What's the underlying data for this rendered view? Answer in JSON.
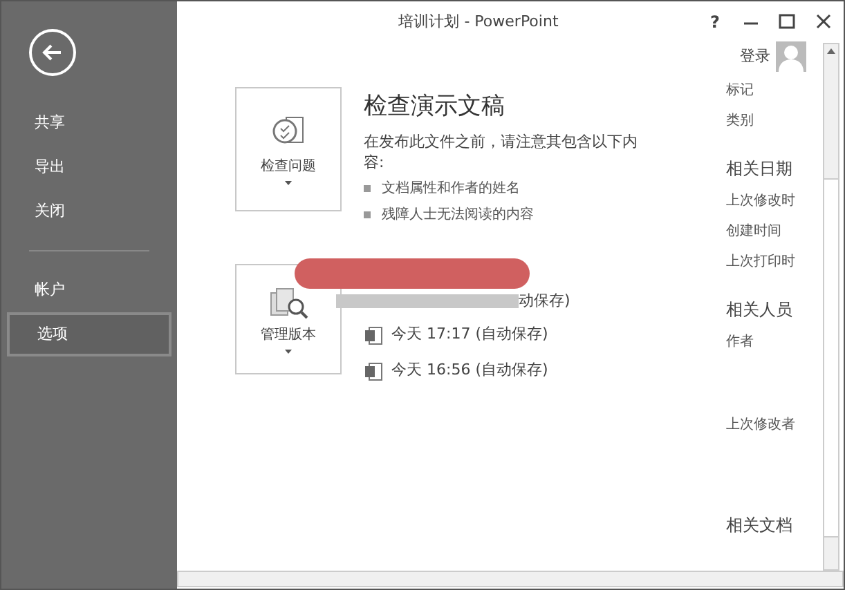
{
  "window": {
    "title": "培训计划 - PowerPoint",
    "signin": "登录",
    "help": "?"
  },
  "sidebar": {
    "groups": [
      [
        {
          "label": "共享",
          "selected": false
        },
        {
          "label": "导出",
          "selected": false
        },
        {
          "label": "关闭",
          "selected": false
        }
      ],
      [
        {
          "label": "帐户",
          "selected": false
        },
        {
          "label": "选项",
          "selected": true
        }
      ]
    ]
  },
  "inspect": {
    "button": "检查问题",
    "title": "检查演示文稿",
    "desc": "在发布此文件之前，请注意其包含以下内容:",
    "bullets": [
      "文档属性和作者的姓名",
      "残障人士无法阅读的内容"
    ]
  },
  "versions": {
    "button": "管理版本",
    "items": [
      {
        "label": "动保存)",
        "redacted": true
      },
      {
        "label": "今天 17:17 (自动保存)",
        "redacted": false
      },
      {
        "label": "今天 16:56 (自动保存)",
        "redacted": false
      }
    ]
  },
  "properties": [
    {
      "kind": "label",
      "text": "标记"
    },
    {
      "kind": "label",
      "text": "类别"
    },
    {
      "kind": "heading",
      "text": "相关日期"
    },
    {
      "kind": "label",
      "text": "上次修改时"
    },
    {
      "kind": "label",
      "text": "创建时间"
    },
    {
      "kind": "label",
      "text": "上次打印时"
    },
    {
      "kind": "heading",
      "text": "相关人员"
    },
    {
      "kind": "label",
      "text": "作者"
    },
    {
      "kind": "gap"
    },
    {
      "kind": "label",
      "text": "上次修改者"
    },
    {
      "kind": "gap"
    },
    {
      "kind": "heading",
      "text": "相关文档"
    }
  ]
}
